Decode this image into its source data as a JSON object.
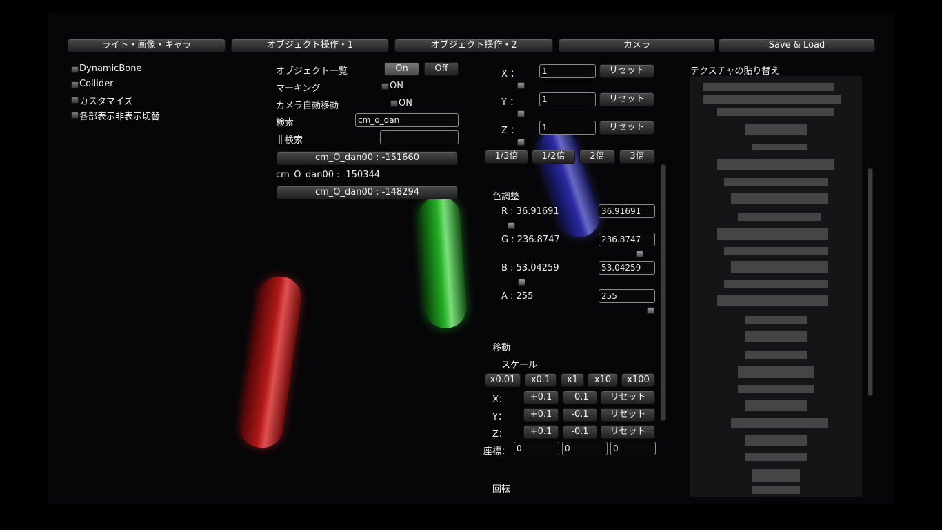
{
  "tabs": [
    {
      "label": "ライト・画像・キャラ"
    },
    {
      "label": "オブジェクト操作・1"
    },
    {
      "label": "オブジェクト操作・2"
    },
    {
      "label": "カメラ"
    },
    {
      "label": "Save & Load"
    }
  ],
  "left_options": [
    {
      "label": "DynamicBone"
    },
    {
      "label": "Collider"
    },
    {
      "label": "カスタマイズ"
    },
    {
      "label": "各部表示非表示切替"
    }
  ],
  "object_panel": {
    "list_label": "オブジェクト一覧",
    "on_label": "On",
    "off_label": "Off",
    "marking_label": "マーキング",
    "marking_toggle": "ON",
    "camera_auto_label": "カメラ自動移動",
    "camera_auto_toggle": "ON",
    "search_label": "検索",
    "search_value": "cm_o_dan",
    "nonsearch_label": "非検索",
    "nonsearch_value": "",
    "items": [
      {
        "text": "cm_O_dan00 : -151660"
      },
      {
        "text": "cm_O_dan00 : -150344"
      },
      {
        "text": "cm_O_dan00 : -148294"
      }
    ]
  },
  "scale_xyz": {
    "x_label": "X ：",
    "x_value": "1",
    "y_label": "Y ：",
    "y_value": "1",
    "z_label": "Z ：",
    "z_value": "1",
    "reset_label": "リセット",
    "mult_buttons": [
      "1/3倍",
      "1/2倍",
      "2倍",
      "3倍"
    ]
  },
  "color": {
    "title": "色調整",
    "r_label": "R : 36.91691",
    "r_value": "36.91691",
    "g_label": "G : 236.8747",
    "g_value": "236.8747",
    "b_label": "B : 53.04259",
    "b_value": "53.04259",
    "a_label": "A : 255",
    "a_value": "255"
  },
  "move": {
    "title": "移動",
    "scale_label": "スケール",
    "scale_buttons": [
      "x0.01",
      "x0.1",
      "x1",
      "x10",
      "x100"
    ],
    "x_label": "X：",
    "y_label": "Y：",
    "z_label": "Z：",
    "plus_label": "+0.1",
    "minus_label": "-0.1",
    "reset_label": "リセット",
    "coord_label": "座標：",
    "coord_values": [
      "0",
      "0",
      "0"
    ]
  },
  "rotate_title": "回転",
  "texture_title": "テクスチャの貼り替え",
  "colors": {
    "capsule_red": "#b01818",
    "capsule_green": "#25b025",
    "capsule_blue": "#3030c0"
  }
}
